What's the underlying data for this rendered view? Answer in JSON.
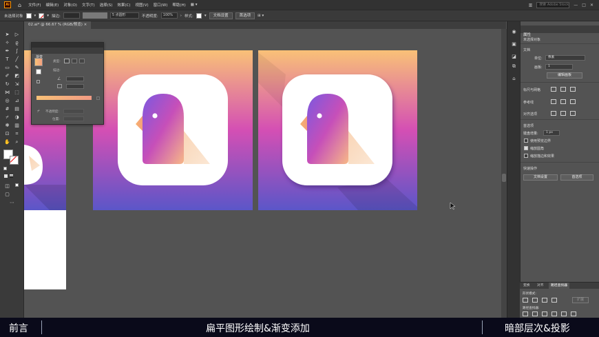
{
  "app": {
    "logo": "Ai",
    "menu": [
      "文件(F)",
      "编辑(E)",
      "对象(O)",
      "文字(T)",
      "选择(S)",
      "效果(C)",
      "视图(V)",
      "窗口(W)",
      "帮助(H)"
    ],
    "search_placeholder": "搜索 Adobe Stock"
  },
  "control_bar": {
    "selection_label": "未选择对象",
    "stroke_label": "描边:",
    "brush_label": "5 点圆形",
    "opacity_label": "不透明度:",
    "opacity_value": "100%",
    "style_label": "样式:",
    "doc_setup_button": "文档设置",
    "prefs_button": "首选项"
  },
  "document": {
    "tab_label": "02.ai* @ 66.67 % (RGB/预览)"
  },
  "gradient_panel": {
    "title": "渐变",
    "type_label": "类型:",
    "stroke_label": "描边:",
    "opacity_label": "不透明度:",
    "location_label": "位置:"
  },
  "properties_panel": {
    "tab_label": "属性",
    "no_selection": "未选择对象",
    "document_section": "文档",
    "units_label": "单位:",
    "units_value": "像素",
    "artboard_label": "画板:",
    "artboard_value": "1",
    "edit_artboards_button": "编辑画板",
    "rulers_grids_label": "标尺与网格",
    "guides_label": "参考线",
    "snap_options_label": "对齐选项",
    "preferences_label": "首选项",
    "keyboard_increment_label": "键盘增量:",
    "keyboard_increment_value": "1 px",
    "checkboxes": [
      {
        "label": "使用预览边界",
        "checked": false
      },
      {
        "label": "缩放圆角",
        "checked": true
      },
      {
        "label": "缩放描边和效果",
        "checked": false
      }
    ],
    "quick_actions_label": "快速操作",
    "doc_setup_button": "文档设置",
    "prefs_button": "首选项"
  },
  "pathfinder_panel": {
    "tabs": [
      "变换",
      "对齐",
      "路径查找器"
    ],
    "active_tab": 2,
    "shape_modes_label": "形状模式:",
    "pathfinder_label": "路径查找器:",
    "expand_button": "扩展"
  },
  "artwork": {
    "gradient_top": "#f9c177",
    "gradient_mid": "#d44fb4",
    "gradient_bottom": "#5b56c8",
    "bird_top": "#8b55e0",
    "bird_bottom": "#f6b98a",
    "bird_wing": "#f9d7b4"
  },
  "subtitle": {
    "left": "前言",
    "middle": "扁平图形绘制&渐变添加",
    "right": "暗部层次&投影"
  }
}
